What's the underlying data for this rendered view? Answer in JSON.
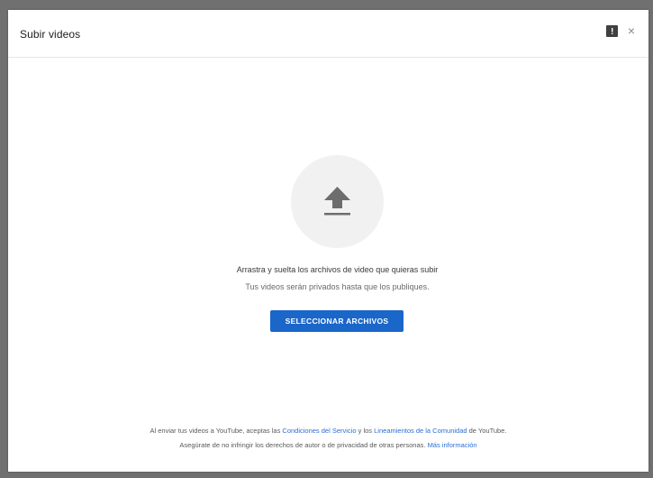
{
  "dialog": {
    "title": "Subir videos",
    "close_label": "×"
  },
  "upload": {
    "icon": "upload-arrow-icon",
    "line1": "Arrastra y suelta los archivos de video que quieras subir",
    "line2": "Tus videos serán privados hasta que los publiques.",
    "button_label": "SELECCIONAR ARCHIVOS"
  },
  "footer": {
    "line1_prefix": "Al enviar tus videos a YouTube, aceptas las ",
    "line1_link1": "Condiciones del Servicio",
    "line1_middle": " y los ",
    "line1_link2": "Lineamientos de la Comunidad",
    "line1_suffix": " de YouTube.",
    "line2_prefix": "Asegúrate de no infringir los derechos de autor o de privacidad de otras personas. ",
    "line2_link": "Más información"
  },
  "colors": {
    "accent": "#1a66c9",
    "link": "#2a6fd6",
    "overlay": "#707070"
  }
}
